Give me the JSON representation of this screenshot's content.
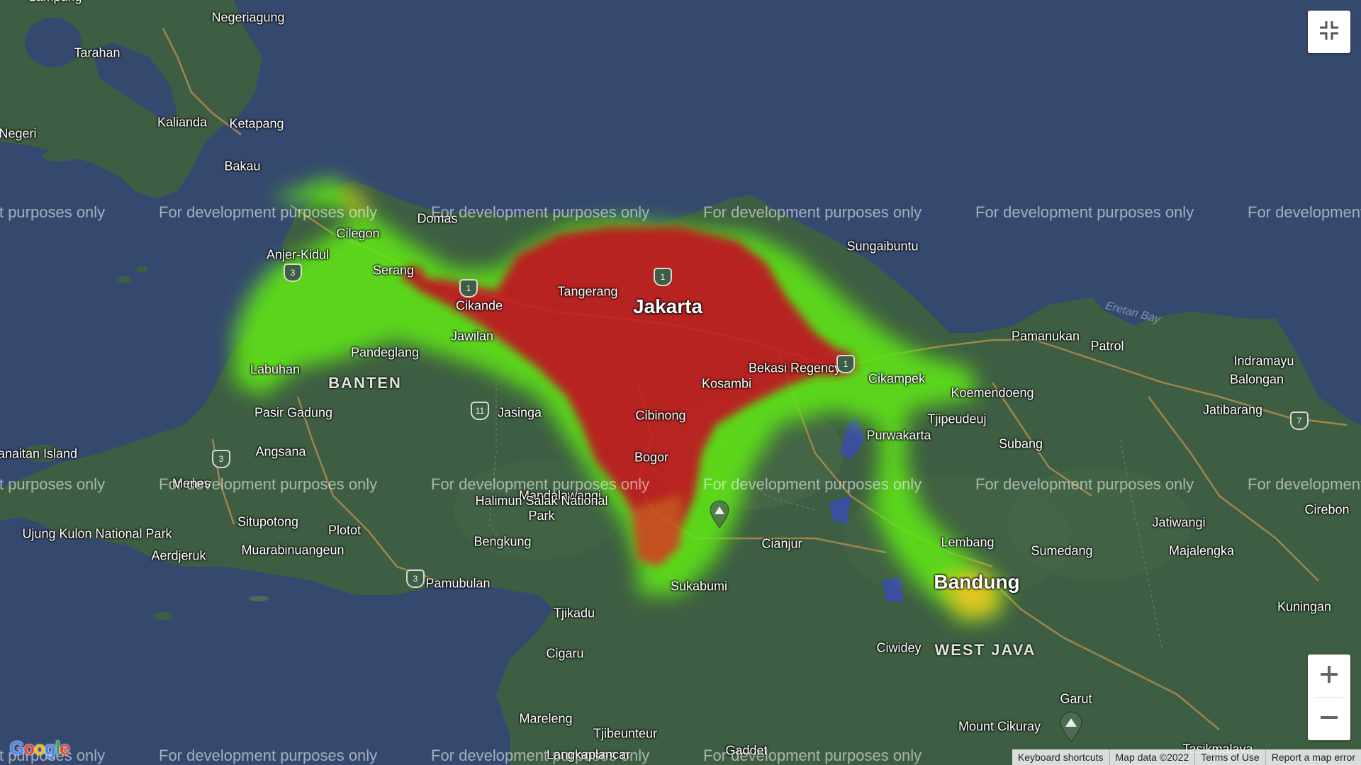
{
  "map": {
    "places": [
      {
        "text": "Negeriagung",
        "cls": "lbl"
      },
      {
        "text": "Tarahan",
        "cls": "lbl"
      },
      {
        "text": "Kalianda",
        "cls": "lbl"
      },
      {
        "text": "Ketapang",
        "cls": "lbl"
      },
      {
        "text": "Negeri",
        "cls": "lbl"
      },
      {
        "text": "Bakau",
        "cls": "lbl"
      },
      {
        "text": "Domas",
        "cls": "lbl"
      },
      {
        "text": "Sungaibuntu",
        "cls": "lbl"
      },
      {
        "text": "Anjer-Kidul",
        "cls": "lbl"
      },
      {
        "text": "Cilegon",
        "cls": "lbl"
      },
      {
        "text": "Serang",
        "cls": "lbl"
      },
      {
        "text": "Tangerang",
        "cls": "lbl"
      },
      {
        "text": "Jakarta",
        "cls": "lbl"
      },
      {
        "text": "Cikande",
        "cls": "lbl"
      },
      {
        "text": "Jawilan",
        "cls": "lbl"
      },
      {
        "text": "Pandeglang",
        "cls": "lbl"
      },
      {
        "text": "Labuhan",
        "cls": "lbl"
      },
      {
        "text": "BANTEN",
        "cls": "lbl"
      },
      {
        "text": "Pamanukan",
        "cls": "lbl"
      },
      {
        "text": "Patrol",
        "cls": "lbl"
      },
      {
        "text": "Indramayu",
        "cls": "lbl"
      },
      {
        "text": "Balongan",
        "cls": "lbl"
      },
      {
        "text": "Eretan Bay",
        "cls": "lbl"
      },
      {
        "text": "Bekasi Regency",
        "cls": "lbl"
      },
      {
        "text": "Cikampek",
        "cls": "lbl"
      },
      {
        "text": "Kosambi",
        "cls": "lbl"
      },
      {
        "text": "Koemendoeng",
        "cls": "lbl"
      },
      {
        "text": "Jatibarang",
        "cls": "lbl"
      },
      {
        "text": "Jasinga",
        "cls": "lbl"
      },
      {
        "text": "Cibinong",
        "cls": "lbl"
      },
      {
        "text": "Pasir Gadung",
        "cls": "lbl"
      },
      {
        "text": "Tjipeudeuj",
        "cls": "lbl"
      },
      {
        "text": "Purwakarta",
        "cls": "lbl"
      },
      {
        "text": "Subang",
        "cls": "lbl"
      },
      {
        "text": "Angsana",
        "cls": "lbl"
      },
      {
        "text": "Bogor",
        "cls": "lbl"
      },
      {
        "text": "anaitan Island",
        "cls": "lbl"
      },
      {
        "text": "Menes",
        "cls": "lbl"
      },
      {
        "text": "Mandalawangi",
        "cls": "lbl"
      },
      {
        "text": "Halimun Salak National Park",
        "cls": "lbl"
      },
      {
        "text": "Cirebon",
        "cls": "lbl"
      },
      {
        "text": "Jatiwangi",
        "cls": "lbl"
      },
      {
        "text": "Ujung Kulon National Park",
        "cls": "lbl"
      },
      {
        "text": "Situpotong",
        "cls": "lbl"
      },
      {
        "text": "Plotot",
        "cls": "lbl"
      },
      {
        "text": "Bengkung",
        "cls": "lbl"
      },
      {
        "text": "Cianjur",
        "cls": "lbl"
      },
      {
        "text": "Lembang",
        "cls": "lbl"
      },
      {
        "text": "Sumedang",
        "cls": "lbl"
      },
      {
        "text": "Majalengka",
        "cls": "lbl"
      },
      {
        "text": "Aerdjeruk",
        "cls": "lbl"
      },
      {
        "text": "Muarabinuangeun",
        "cls": "lbl"
      },
      {
        "text": "Pamubulan",
        "cls": "lbl"
      },
      {
        "text": "Sukabumi",
        "cls": "lbl"
      },
      {
        "text": "Bandung",
        "cls": "lbl"
      },
      {
        "text": "Kuningan",
        "cls": "lbl"
      },
      {
        "text": "Tjikadu",
        "cls": "lbl"
      },
      {
        "text": "Ciwidey",
        "cls": "lbl"
      },
      {
        "text": "WEST JAVA",
        "cls": "lbl"
      },
      {
        "text": "Cigaru",
        "cls": "lbl"
      },
      {
        "text": "Garut",
        "cls": "lbl"
      },
      {
        "text": "Mareleng",
        "cls": "lbl"
      },
      {
        "text": "Tjibeunteur",
        "cls": "lbl"
      },
      {
        "text": "Mount Cikuray",
        "cls": "lbl"
      },
      {
        "text": "Gaddet",
        "cls": "lbl"
      },
      {
        "text": "Tasikmalaya",
        "cls": "lbl"
      },
      {
        "text": "Lampung",
        "cls": "lbl"
      },
      {
        "text": "Langkaplancar",
        "cls": "lbl"
      }
    ],
    "road_shields": [
      "1",
      "1",
      "3",
      "11",
      "1",
      "3",
      "3",
      "7"
    ],
    "watermark_text": "For development purposes only"
  },
  "controls": {
    "fullscreen_icon": "exit-fullscreen-icon",
    "zoom_in_icon": "plus-icon",
    "zoom_out_icon": "minus-icon"
  },
  "footer": {
    "logo": "Google",
    "keyboard": "Keyboard shortcuts",
    "map_data": "Map data ©2022",
    "terms": "Terms of Use",
    "report": "Report a map error"
  },
  "colors": {
    "sea": "#35496f",
    "land": "#3e5e43",
    "heat_high": "#c81e1e",
    "heat_mid": "#ffd21e",
    "heat_low": "#5ee614"
  }
}
